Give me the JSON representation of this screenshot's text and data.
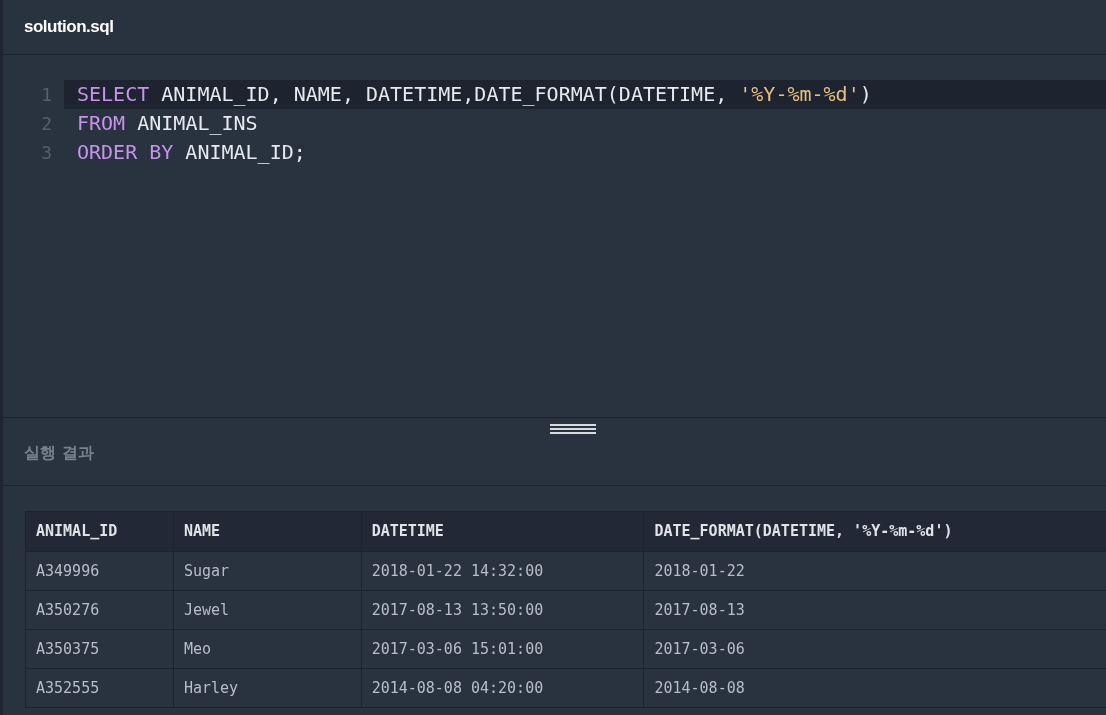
{
  "file_tab": {
    "title": "solution.sql"
  },
  "editor": {
    "lines": [
      {
        "number": "1",
        "active": true,
        "tokens": [
          {
            "kind": "keyword",
            "text": "SELECT"
          },
          {
            "kind": "plain",
            "text": " ANIMAL_ID, NAME, DATETIME,DATE_FORMAT(DATETIME, "
          },
          {
            "kind": "string",
            "text": "'%Y-%m-%d'"
          },
          {
            "kind": "plain",
            "text": ")"
          }
        ]
      },
      {
        "number": "2",
        "active": false,
        "tokens": [
          {
            "kind": "keyword",
            "text": "FROM"
          },
          {
            "kind": "plain",
            "text": " ANIMAL_INS"
          }
        ]
      },
      {
        "number": "3",
        "active": false,
        "tokens": [
          {
            "kind": "keyword",
            "text": "ORDER BY"
          },
          {
            "kind": "plain",
            "text": " ANIMAL_ID;"
          }
        ]
      }
    ]
  },
  "results": {
    "title": "실행 결과",
    "table": {
      "columns": [
        "ANIMAL_ID",
        "NAME",
        "DATETIME",
        "DATE_FORMAT(DATETIME, '%Y-%m-%d')"
      ],
      "rows": [
        [
          "A349996",
          "Sugar",
          "2018-01-22 14:32:00",
          "2018-01-22"
        ],
        [
          "A350276",
          "Jewel",
          "2017-08-13 13:50:00",
          "2017-08-13"
        ],
        [
          "A350375",
          "Meo",
          "2017-03-06 15:01:00",
          "2017-03-06"
        ],
        [
          "A352555",
          "Harley",
          "2014-08-08 04:20:00",
          "2014-08-08"
        ]
      ]
    }
  }
}
